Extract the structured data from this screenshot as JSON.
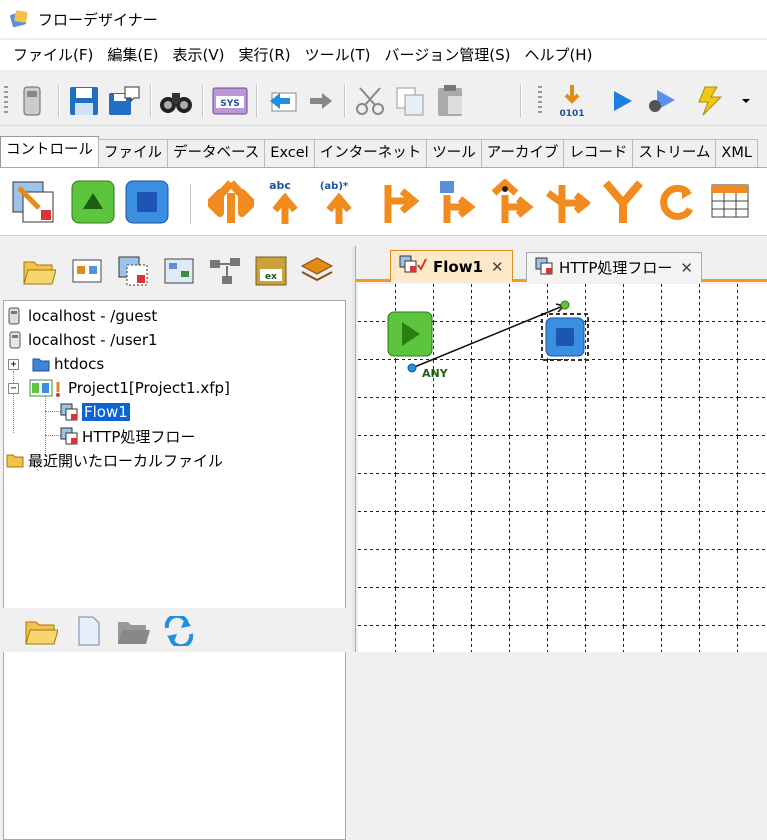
{
  "window": {
    "title": "フローデザイナー"
  },
  "menu": [
    "ファイル(F)",
    "編集(E)",
    "表示(V)",
    "実行(R)",
    "ツール(T)",
    "バージョン管理(S)",
    "ヘルプ(H)"
  ],
  "toolbar": {
    "icons": [
      "clipboard-icon",
      "save-icon",
      "save-as-icon",
      "find-icon",
      "system-variables-icon",
      "undo-icon",
      "redo-icon",
      "cut-icon",
      "copy-icon",
      "paste-icon",
      "debug-step-icon",
      "run-icon",
      "debug-run-icon",
      "lightning-icon",
      "dropdown-icon"
    ],
    "step_label": "0101",
    "sys_label": "SYS"
  },
  "palette": {
    "tabs": [
      "コントロール",
      "ファイル",
      "データベース",
      "Excel",
      "インターネット",
      "ツール",
      "アーカイブ",
      "レコード",
      "ストリーム",
      "XML"
    ],
    "active_tab": 0,
    "abc_label": "abc",
    "ab_label": "(ab)*"
  },
  "project_tree": {
    "nodes": [
      {
        "label": "localhost - /guest",
        "icon": "server-guest-icon"
      },
      {
        "label": "localhost - /user1",
        "icon": "server-icon"
      },
      {
        "label": "htdocs",
        "icon": "folder-icon"
      },
      {
        "label": "Project1[Project1.xfp]",
        "icon": "project-icon"
      },
      {
        "label": "Flow1",
        "icon": "flow-icon",
        "selected": true
      },
      {
        "label": "HTTP処理フロー",
        "icon": "flow-icon"
      },
      {
        "label": "最近開いたローカルファイル",
        "icon": "folder-icon"
      }
    ]
  },
  "editor": {
    "tabs": [
      {
        "label": "Flow1",
        "active": true,
        "close": "✕"
      },
      {
        "label": "HTTP処理フロー",
        "active": false,
        "close": "✕"
      }
    ],
    "canvas": {
      "connector_label": "ANY"
    }
  },
  "colors": {
    "accent": "#f39a21",
    "selection": "#0a64d8"
  }
}
